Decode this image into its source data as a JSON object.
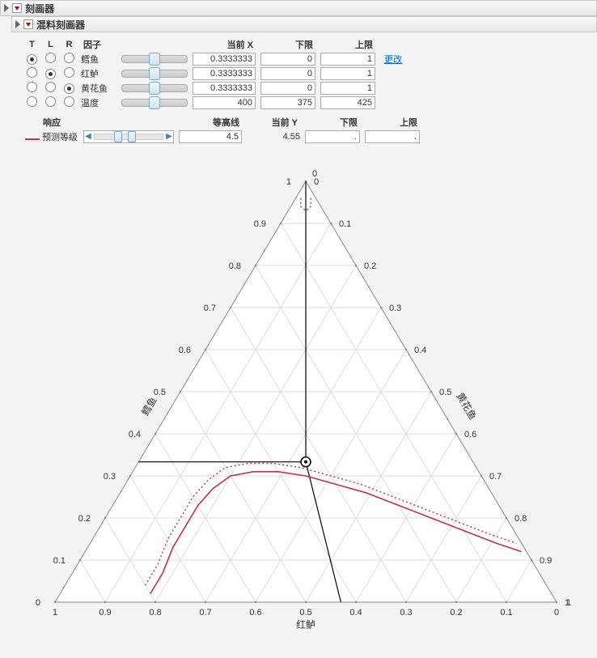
{
  "titles": {
    "main": "刻画器",
    "sub": "混料刻画器"
  },
  "headers": {
    "T": "T",
    "L": "L",
    "R": "R",
    "factor": "因子",
    "curX": "当前 X",
    "lo": "下限",
    "hi": "上限",
    "change": "更改",
    "response": "响应",
    "contour": "等高线",
    "curY": "当前 Y"
  },
  "factors": [
    {
      "name": "鳕鱼",
      "sel": [
        true,
        false,
        false
      ],
      "pos": 50,
      "x": "0.3333333",
      "lo": "0",
      "hi": "1"
    },
    {
      "name": "红鲈",
      "sel": [
        false,
        true,
        false
      ],
      "pos": 50,
      "x": "0.3333333",
      "lo": "0",
      "hi": "1"
    },
    {
      "name": "黄花鱼",
      "sel": [
        false,
        false,
        true
      ],
      "pos": 50,
      "x": "0.3333333",
      "lo": "0",
      "hi": "1"
    },
    {
      "name": "温度",
      "sel": [
        false,
        false,
        false
      ],
      "pos": 50,
      "x": "400",
      "lo": "375",
      "hi": "425"
    }
  ],
  "resp": {
    "name": "预测等级",
    "contour": "4.5",
    "curY": "4.55",
    "lo": ".",
    "hi": "."
  },
  "axes": {
    "top": "鳕鱼",
    "left": "红鲈",
    "right": "黄花鱼"
  },
  "ticks": [
    "0",
    "0.1",
    "0.2",
    "0.3",
    "0.4",
    "0.5",
    "0.6",
    "0.7",
    "0.8",
    "0.9",
    "1"
  ],
  "chart_data": {
    "type": "ternary",
    "title": "混料刻画器",
    "vertices": {
      "top": "鳕鱼",
      "bottom_left": "红鲈",
      "bottom_right": "黄花鱼"
    },
    "axis_range": [
      0,
      1
    ],
    "tick_interval": 0.1,
    "current_point": {
      "鳕鱼": 0.3333333,
      "红鲈": 0.3333333,
      "黄花鱼": 0.3333333
    },
    "contour_level": 4.5,
    "predicted_response": 4.55,
    "contour_curve_approx": [
      {
        "红鲈": 0.8,
        "鳕鱼": 0.02
      },
      {
        "红鲈": 0.75,
        "鳕鱼": 0.07
      },
      {
        "红鲈": 0.7,
        "鳕鱼": 0.13
      },
      {
        "红鲈": 0.65,
        "鳕鱼": 0.18
      },
      {
        "红鲈": 0.6,
        "鳕鱼": 0.23
      },
      {
        "红鲈": 0.55,
        "鳕鱼": 0.27
      },
      {
        "红鲈": 0.5,
        "鳕鱼": 0.3
      },
      {
        "红鲈": 0.45,
        "鳕鱼": 0.31
      },
      {
        "红鲈": 0.4,
        "鳕鱼": 0.31
      },
      {
        "红鲈": 0.35,
        "鳕鱼": 0.3
      },
      {
        "红鲈": 0.3,
        "鳕鱼": 0.28
      },
      {
        "红鲈": 0.25,
        "鳕鱼": 0.26
      },
      {
        "红鲈": 0.2,
        "鳕鱼": 0.23
      },
      {
        "红鲈": 0.15,
        "鳕鱼": 0.2
      },
      {
        "红鲈": 0.1,
        "鳕鱼": 0.17
      },
      {
        "红鲈": 0.05,
        "鳕鱼": 0.14
      },
      {
        "红鲈": 0.01,
        "鳕鱼": 0.12
      }
    ],
    "trace_lines": [
      {
        "from": "center",
        "to_edge": "left",
        "at_top_fraction": 0.3333
      },
      {
        "from": "center",
        "to_vertex": "top"
      },
      {
        "from": "center",
        "to_edge": "bottom",
        "at": "0.43"
      }
    ]
  }
}
